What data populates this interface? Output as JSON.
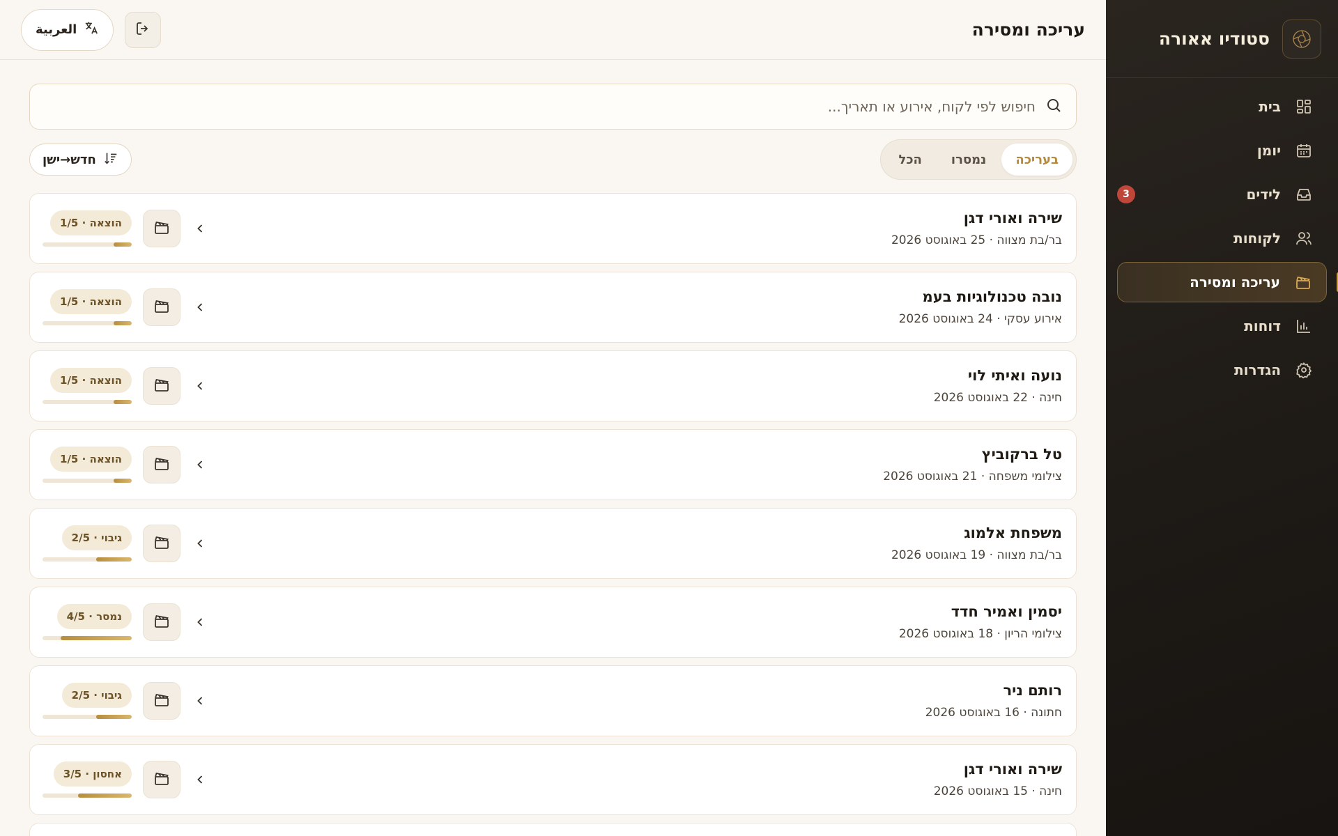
{
  "sidebar": {
    "brand": "סטודיו אאורה",
    "items": [
      {
        "label": "בית",
        "icon": "dashboard-icon"
      },
      {
        "label": "יומן",
        "icon": "calendar-icon"
      },
      {
        "label": "לידים",
        "icon": "inbox-icon",
        "badge": "3"
      },
      {
        "label": "לקוחות",
        "icon": "users-icon"
      },
      {
        "label": "עריכה ומסירה",
        "icon": "clapperboard-icon",
        "active": true
      },
      {
        "label": "דוחות",
        "icon": "bar-chart-icon"
      },
      {
        "label": "הגדרות",
        "icon": "gear-icon"
      }
    ]
  },
  "header": {
    "title": "עריכה ומסירה",
    "language_label": "العربية"
  },
  "search": {
    "placeholder": "חיפוש לפי לקוח, אירוע או תאריך..."
  },
  "tabs": [
    {
      "label": "בעריכה",
      "active": true
    },
    {
      "label": "נמסרו"
    },
    {
      "label": "הכל"
    }
  ],
  "sort": {
    "label": "חדש→ישן"
  },
  "projects": [
    {
      "name": "שירה ואורי דגן",
      "meta": "בר/בת מצווה · 25 באוגוסט 2026",
      "status": "הוצאה · 1/5",
      "progress": 0.2
    },
    {
      "name": "נובה טכנולוגיות בעמ",
      "meta": "אירוע עסקי · 24 באוגוסט 2026",
      "status": "הוצאה · 1/5",
      "progress": 0.2
    },
    {
      "name": "נועה ואיתי לוי",
      "meta": "חינה · 22 באוגוסט 2026",
      "status": "הוצאה · 1/5",
      "progress": 0.2
    },
    {
      "name": "טל ברקוביץ",
      "meta": "צילומי משפחה · 21 באוגוסט 2026",
      "status": "הוצאה · 1/5",
      "progress": 0.2
    },
    {
      "name": "משפחת אלמוג",
      "meta": "בר/בת מצווה · 19 באוגוסט 2026",
      "status": "גיבוי · 2/5",
      "progress": 0.4
    },
    {
      "name": "יסמין ואמיר חדד",
      "meta": "צילומי הריון · 18 באוגוסט 2026",
      "status": "נמסר · 4/5",
      "progress": 0.8
    },
    {
      "name": "רותם ניר",
      "meta": "חתונה · 16 באוגוסט 2026",
      "status": "גיבוי · 2/5",
      "progress": 0.4
    },
    {
      "name": "שירה ואורי דגן",
      "meta": "חינה · 15 באוגוסט 2026",
      "status": "אחסון · 3/5",
      "progress": 0.6
    }
  ]
}
